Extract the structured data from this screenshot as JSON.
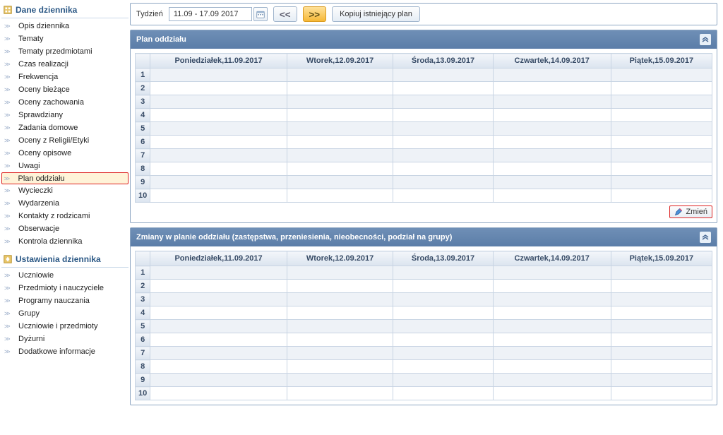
{
  "sidebar": {
    "section1": {
      "title": "Dane dziennika",
      "items": [
        {
          "label": "Opis dziennika",
          "selected": false
        },
        {
          "label": "Tematy",
          "selected": false
        },
        {
          "label": "Tematy przedmiotami",
          "selected": false
        },
        {
          "label": "Czas realizacji",
          "selected": false
        },
        {
          "label": "Frekwencja",
          "selected": false
        },
        {
          "label": "Oceny bieżące",
          "selected": false
        },
        {
          "label": "Oceny zachowania",
          "selected": false
        },
        {
          "label": "Sprawdziany",
          "selected": false
        },
        {
          "label": "Zadania domowe",
          "selected": false
        },
        {
          "label": "Oceny z Religii/Etyki",
          "selected": false
        },
        {
          "label": "Oceny opisowe",
          "selected": false
        },
        {
          "label": "Uwagi",
          "selected": false
        },
        {
          "label": "Plan oddziału",
          "selected": true
        },
        {
          "label": "Wycieczki",
          "selected": false
        },
        {
          "label": "Wydarzenia",
          "selected": false
        },
        {
          "label": "Kontakty z rodzicami",
          "selected": false
        },
        {
          "label": "Obserwacje",
          "selected": false
        },
        {
          "label": "Kontrola dziennika",
          "selected": false
        }
      ]
    },
    "section2": {
      "title": "Ustawienia dziennika",
      "items": [
        {
          "label": "Uczniowie"
        },
        {
          "label": "Przedmioty i nauczyciele"
        },
        {
          "label": "Programy nauczania"
        },
        {
          "label": "Grupy"
        },
        {
          "label": "Uczniowie i przedmioty"
        },
        {
          "label": "Dyżurni"
        },
        {
          "label": "Dodatkowe informacje"
        }
      ]
    }
  },
  "toolbar": {
    "week_label": "Tydzień",
    "week_value": "11.09 - 17.09 2017",
    "prev": "<<",
    "next": ">>",
    "copy": "Kopiuj istniejący plan"
  },
  "panel1": {
    "title": "Plan oddziału",
    "days": [
      "Poniedziałek,11.09.2017",
      "Wtorek,12.09.2017",
      "Środa,13.09.2017",
      "Czwartek,14.09.2017",
      "Piątek,15.09.2017"
    ],
    "rows": [
      1,
      2,
      3,
      4,
      5,
      6,
      7,
      8,
      9,
      10
    ],
    "zmien": "Zmień"
  },
  "panel2": {
    "title": "Zmiany w planie oddziału (zastępstwa, przeniesienia, nieobecności, podział na grupy)",
    "days": [
      "Poniedziałek,11.09.2017",
      "Wtorek,12.09.2017",
      "Środa,13.09.2017",
      "Czwartek,14.09.2017",
      "Piątek,15.09.2017"
    ],
    "rows": [
      1,
      2,
      3,
      4,
      5,
      6,
      7,
      8,
      9,
      10
    ]
  }
}
